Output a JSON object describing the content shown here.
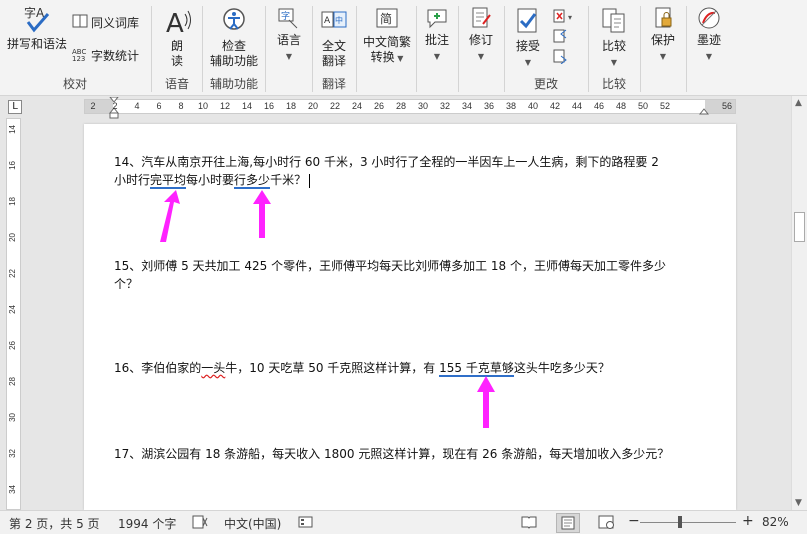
{
  "ribbon": {
    "proofing": {
      "spelling_label": "拼写和语法",
      "thesaurus_label": "同义词库",
      "wordcount_label": "字数统计",
      "group_label": "校对"
    },
    "speech": {
      "read_label_1": "朗",
      "read_label_2": "读",
      "group_label": "语音"
    },
    "accessibility": {
      "check_label_1": "检查",
      "check_label_2": "辅助功能",
      "group_label": "辅助功能"
    },
    "language": {
      "label": "语言"
    },
    "translate": {
      "label_1": "全文",
      "label_2": "翻译",
      "group_label": "翻译"
    },
    "chinese": {
      "label_1": "中文简繁",
      "label_2": "转换"
    },
    "comments": {
      "label": "批注"
    },
    "track": {
      "label": "修订"
    },
    "changes": {
      "accept_label": "接受",
      "group_label": "更改"
    },
    "compare": {
      "label": "比较",
      "group_label": "比较"
    },
    "protect": {
      "label": "保护"
    },
    "ink": {
      "label": "墨迹"
    }
  },
  "ruler": {
    "corner": "L",
    "ticks": [
      "2",
      "2",
      "4",
      "6",
      "8",
      "10",
      "12",
      "14",
      "16",
      "18",
      "20",
      "22",
      "24",
      "26",
      "28",
      "30",
      "32",
      "34",
      "36",
      "38",
      "40",
      "42",
      "44",
      "46",
      "48",
      "50",
      "52",
      "56"
    ],
    "vticks": [
      "14",
      "16",
      "18",
      "20",
      "22",
      "24",
      "26",
      "28",
      "30",
      "32",
      "34"
    ]
  },
  "document": {
    "q14_line1": "14、汽车从南京开往上海,每小时行 60 千米，3 小时行了全程的一半因车上一人生病，剩下的路程要 2",
    "q14_line2_a": "小时行",
    "q14_line2_b": "完平均",
    "q14_line2_c": "每小时要",
    "q14_line2_d": "行多少",
    "q14_line2_e": "千米？",
    "q15_line1": "15、刘师傅 5 天共加工 425 个零件，王师傅平均每天比刘师傅多加工 18 个，王师傅每天加工零件多少",
    "q15_line2": "个？",
    "q16_a": "16、李伯伯家的",
    "q16_b": "一头",
    "q16_c": "牛，10 天吃草 50 千克照这样计算，有 ",
    "q16_d": "155 千克草够",
    "q16_e": "这头牛吃多少天？",
    "q17": "17、湖滨公园有 18 条游船，每天收入 1800 元照这样计算，现在有 26 条游船，每天增加收入多少元？"
  },
  "status": {
    "page": "第 2 页，共 5 页",
    "words": "1994 个字",
    "language": "中文(中国)",
    "zoom_minus": "−",
    "zoom_plus": "+",
    "zoom": "82%"
  },
  "colors": {
    "arrow": "#ff22ff",
    "blue_underline": "#2f6fc9",
    "ribbon_bg": "#f3f3f3"
  }
}
